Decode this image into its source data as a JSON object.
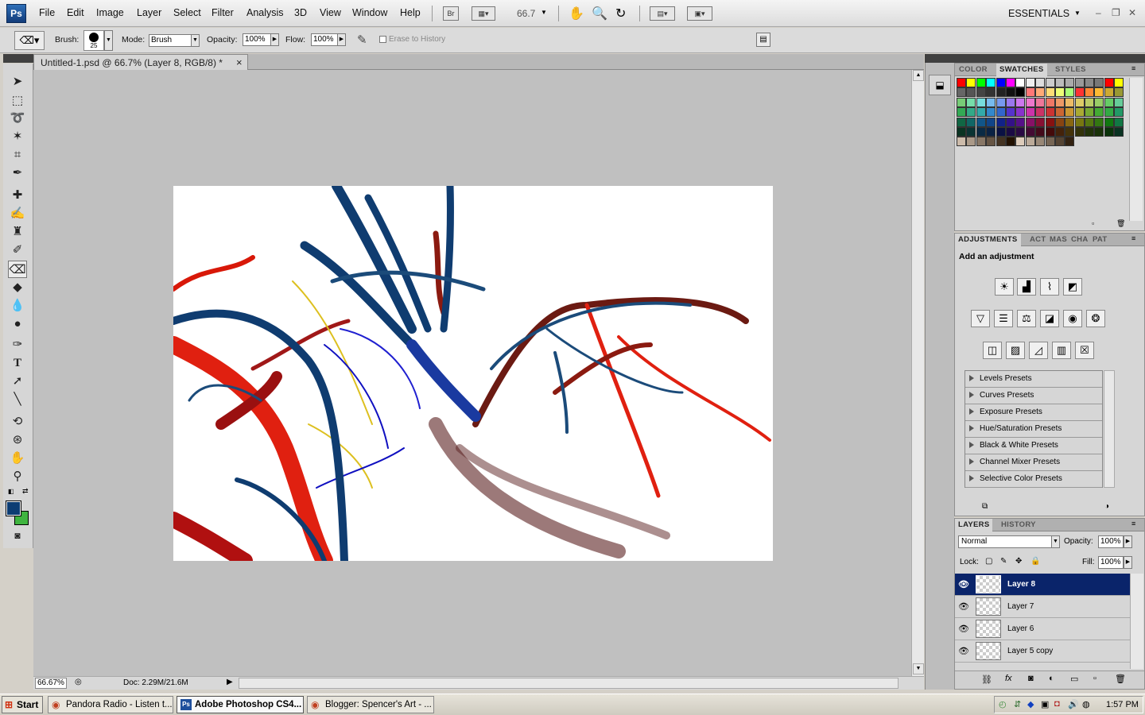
{
  "app": {
    "logo": "Ps",
    "menus": [
      "File",
      "Edit",
      "Image",
      "Layer",
      "Select",
      "Filter",
      "Analysis",
      "3D",
      "View",
      "Window",
      "Help"
    ],
    "bridge_label": "Br",
    "zoom": "66.7",
    "workspace": "ESSENTIALS",
    "window_controls": [
      "–",
      "❐",
      "✕"
    ]
  },
  "options": {
    "brush_label": "Brush:",
    "brush_size": "25",
    "mode_label": "Mode:",
    "mode_value": "Brush",
    "opacity_label": "Opacity:",
    "opacity_value": "100%",
    "flow_label": "Flow:",
    "flow_value": "100%",
    "erase_history": "Erase to History"
  },
  "document": {
    "tab_title": "Untitled-1.psd @ 66.7% (Layer 8, RGB/8) *",
    "tab_close": "×",
    "status_zoom": "66.67%",
    "status_doc": "Doc: 2.29M/21.6M"
  },
  "color_panel": {
    "tabs": [
      "COLOR",
      "SWATCHES",
      "STYLES"
    ],
    "swatches": [
      "#ff0000",
      "#ffff00",
      "#00ff00",
      "#00ffff",
      "#0000ff",
      "#ff00ff",
      "#ffffff",
      "#eeeeee",
      "#dddddd",
      "#cccccc",
      "#bbbbbb",
      "#aaaaaa",
      "#999999",
      "#888888",
      "#777777",
      "#ff0000",
      "#ffff00",
      "#666666",
      "#555555",
      "#444444",
      "#333333",
      "#222222",
      "#111111",
      "#000000",
      "#ff7777",
      "#ffaa77",
      "#ffdd77",
      "#eeff77",
      "#aaff77",
      "#ff3333",
      "#ff8833",
      "#ffbb33",
      "#ccaa33",
      "#999933",
      "#77cc77",
      "#77ddaa",
      "#77dddd",
      "#77bbee",
      "#7799ee",
      "#9977ee",
      "#cc77ee",
      "#ee77cc",
      "#ee7799",
      "#ee7766",
      "#ee9966",
      "#eebb66",
      "#ddcc66",
      "#bbcc66",
      "#99cc66",
      "#66cc66",
      "#66cc99",
      "#33aa55",
      "#33aa88",
      "#33aaaa",
      "#3388cc",
      "#3366cc",
      "#5533cc",
      "#8833cc",
      "#cc33aa",
      "#cc3366",
      "#cc3333",
      "#cc6633",
      "#cc9933",
      "#aaaa33",
      "#77aa33",
      "#44aa33",
      "#33aa44",
      "#229966",
      "#116644",
      "#116666",
      "#115588",
      "#114488",
      "#112288",
      "#331188",
      "#551188",
      "#881166",
      "#881133",
      "#881111",
      "#884411",
      "#886611",
      "#777711",
      "#557711",
      "#337711",
      "#117711",
      "#117744",
      "#0a3322",
      "#0a3333",
      "#0a2a44",
      "#0a2244",
      "#0a1144",
      "#1a0a44",
      "#2a0a44",
      "#440a33",
      "#440a1a",
      "#440a0a",
      "#44220a",
      "#44330a",
      "#33330a",
      "#22330a",
      "#1a330a",
      "#0a330a",
      "#0a3322",
      "#ccbbaa",
      "#aa9988",
      "#887766",
      "#665544",
      "#443322",
      "#221100",
      "#ddccbb",
      "#bbaa99",
      "#998877",
      "#776655",
      "#554433",
      "#332211"
    ]
  },
  "adjustments": {
    "tabs": [
      "ADJUSTMENTS",
      "ACT",
      "MAS",
      "CHA",
      "PAT"
    ],
    "heading": "Add an adjustment",
    "presets": [
      "Levels Presets",
      "Curves Presets",
      "Exposure Presets",
      "Hue/Saturation Presets",
      "Black & White Presets",
      "Channel Mixer Presets",
      "Selective Color Presets"
    ]
  },
  "layers": {
    "tabs": [
      "LAYERS",
      "HISTORY"
    ],
    "blend_mode": "Normal",
    "opacity_label": "Opacity:",
    "opacity_value": "100%",
    "lock_label": "Lock:",
    "fill_label": "Fill:",
    "fill_value": "100%",
    "items": [
      {
        "name": "Layer 8",
        "selected": true
      },
      {
        "name": "Layer 7",
        "selected": false
      },
      {
        "name": "Layer 6",
        "selected": false
      },
      {
        "name": "Layer 5 copy",
        "selected": false
      }
    ],
    "footer_icons": [
      "link-icon",
      "fx-icon",
      "mask-icon",
      "adjustment-icon",
      "group-icon",
      "new-layer-icon",
      "trash-icon"
    ]
  },
  "taskbar": {
    "start": "Start",
    "buttons": [
      {
        "label": "Pandora Radio - Listen t...",
        "active": false
      },
      {
        "label": "Adobe Photoshop CS4...",
        "active": true
      },
      {
        "label": "Blogger: Spencer's Art - ...",
        "active": false
      }
    ],
    "clock": "1:57 PM"
  },
  "colors": {
    "foreground": "#0d3d73",
    "background": "#3fb43f",
    "selected_layer": "#0a246a"
  }
}
